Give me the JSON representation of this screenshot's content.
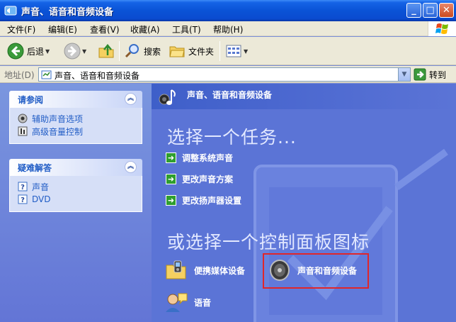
{
  "window": {
    "title": "声音、语音和音频设备",
    "buttons": {
      "minimize": "_",
      "maximize": "□",
      "close": "✕"
    }
  },
  "menubar": {
    "items": [
      "文件(F)",
      "编辑(E)",
      "查看(V)",
      "收藏(A)",
      "工具(T)",
      "帮助(H)"
    ]
  },
  "toolbar": {
    "back_label": "后退",
    "search_label": "搜索",
    "folders_label": "文件夹"
  },
  "address": {
    "label": "地址(D)",
    "value": "声音、语音和音频设备",
    "go_label": "转到"
  },
  "sidebar": {
    "see_also": {
      "title": "请参阅",
      "items": [
        {
          "label": "辅助声音选项",
          "icon": "speaker-accessibility-icon"
        },
        {
          "label": "高级音量控制",
          "icon": "volume-control-icon"
        }
      ]
    },
    "troubleshoot": {
      "title": "疑难解答",
      "items": [
        {
          "label": "声音",
          "icon": "help-icon"
        },
        {
          "label": "DVD",
          "icon": "help-icon"
        }
      ]
    }
  },
  "main": {
    "header_title": "声音、语音和音频设备",
    "pick_task": "选择一个任务...",
    "tasks": [
      "调整系统声音",
      "更改声音方案",
      "更改扬声器设置"
    ],
    "or_pick": "或选择一个控制面板图标",
    "icons": [
      {
        "label": "便携媒体设备",
        "icon": "portable-media-icon"
      },
      {
        "label": "声音和音频设备",
        "icon": "speaker-icon"
      },
      {
        "label": "语音",
        "icon": "speech-icon"
      }
    ]
  },
  "colors": {
    "titlebar": "#0a53d6",
    "main_bg": "#5b74d6",
    "highlight": "#e0262a",
    "task_arrow": "#2f9e2f"
  }
}
